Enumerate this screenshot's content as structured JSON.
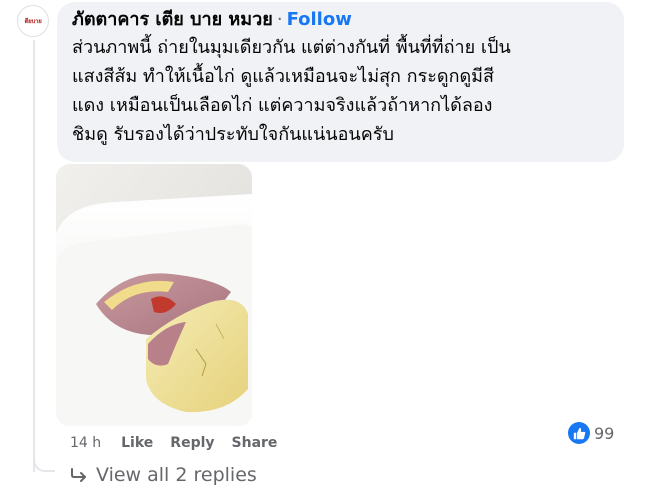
{
  "avatar": {
    "text": "ตียบาย"
  },
  "comment": {
    "author": "ภัตตาคาร เตีย บาย หมวย",
    "separator": "·",
    "follow_label": "Follow",
    "text": "ส่วนภาพนี้ ถ่ายในมุมเดียวกัน แต่ต่างกันที่ พื้นที่ที่ถ่าย เป็น\nแสงสีส้ม ทำให้เนื้อไก่ ดูแล้วเหมือนจะไม่สุก กระดูกดูมีสี\nแดง เหมือนเป็นเลือดไก่ แต่ความจริงแล้วถ้าหากได้ลอง\nชิมดู รับรองได้ว่าประทับใจกันแน่นอนครับ",
    "time": "14 h",
    "like_label": "Like",
    "reply_label": "Reply",
    "share_label": "Share",
    "reaction_count": "99"
  },
  "replies": {
    "view_all_label": "View all 2 replies"
  },
  "icons": {
    "reaction": "like-thumb-icon",
    "replies_arrow": "reply-arrow-icon"
  },
  "colors": {
    "bubble_bg": "#f0f2f5",
    "link_blue": "#1877f2",
    "secondary_text": "#65676b"
  }
}
